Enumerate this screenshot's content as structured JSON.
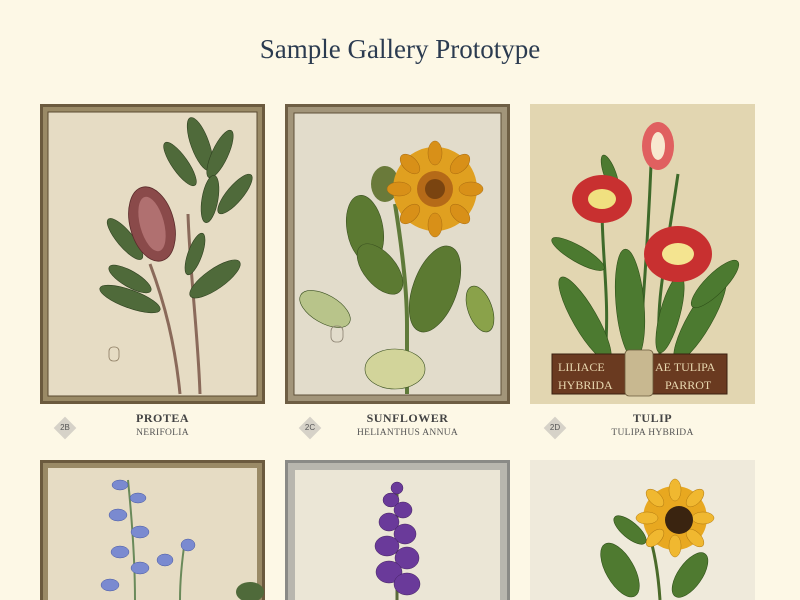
{
  "page": {
    "title": "Sample Gallery Prototype"
  },
  "colors": {
    "background": "#fdf8e6",
    "title": "#2b3b50",
    "badge": "#d6d2c8"
  },
  "gallery": {
    "items": [
      {
        "code": "2B",
        "name": "PROTEA",
        "subtitle": "NERIFOLIA",
        "image": "protea-illustration"
      },
      {
        "code": "2C",
        "name": "SUNFLOWER",
        "subtitle": "HELIANTHUS ANNUA",
        "image": "sunflower-illustration"
      },
      {
        "code": "2D",
        "name": "TULIP",
        "subtitle": "TULIPA HYBRIDA",
        "image": "parrot-tulip-illustration",
        "image_text": [
          "LILIACE",
          "AE TULIPA",
          "HYBRIDA",
          "PARROT"
        ]
      },
      {
        "image": "bluebell-illustration"
      },
      {
        "image": "delphinium-illustration"
      },
      {
        "image": "sunflower-sketch-illustration"
      }
    ]
  }
}
